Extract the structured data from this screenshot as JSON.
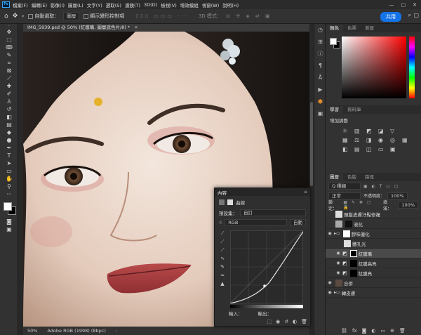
{
  "menubar": {
    "app_icon": "Ps",
    "items": [
      "檔案(F)",
      "編輯(E)",
      "影像(I)",
      "圖層(L)",
      "文字(Y)",
      "選取(S)",
      "濾鏡(T)",
      "3D(D)",
      "檢視(V)",
      "增效模組",
      "視窗(W)",
      "說明(H)"
    ],
    "window_controls": [
      "—",
      "▢",
      "✕"
    ]
  },
  "options": {
    "auto_select_label": "自動選取：",
    "auto_select_value": "圖層",
    "transform_label": "顯示變形控制項",
    "mode_3d": "3D 模式：",
    "share_label": "共用"
  },
  "document": {
    "tab_title": "IMG_5939.psd @ 50% (紅膜嘴, 圖層遮色片/8) *",
    "zoom": "50%",
    "color_profile": "Adobe RGB (1998) (8bpc)"
  },
  "color_panel": {
    "tabs": [
      "顏色",
      "色票",
      "漸層"
    ],
    "hue_color": "#ff0000"
  },
  "adjust_panel": {
    "tabs": [
      "學習",
      "資料庫"
    ],
    "title": "增加調整"
  },
  "layers_panel": {
    "tabs": [
      "圖層",
      "色版",
      "路徑"
    ],
    "filter": "Q 種類",
    "blend_mode": "正常",
    "opacity_label": "不透明度：",
    "opacity": "100%",
    "lock_label": "鎖定：",
    "fill_label": "填滿：",
    "fill": "100%",
    "layers": [
      {
        "name": "頭髮皮膚汙點修複",
        "selected": false
      },
      {
        "name": "液化",
        "selected": false
      },
      {
        "name": "膠味優化",
        "selected": false
      },
      {
        "name": "體孔光",
        "selected": false
      },
      {
        "name": "紅膜嘴",
        "selected": true
      },
      {
        "name": "紅膜高亮",
        "selected": false
      },
      {
        "name": "紅膜亮",
        "selected": false
      },
      {
        "name": "合併",
        "selected": false
      },
      {
        "name": "轉皮膚",
        "selected": false
      }
    ]
  },
  "properties": {
    "tab": "內容",
    "type_label": "曲線",
    "preset_label": "預設集：",
    "preset_value": "自訂",
    "channel_value": "RGB",
    "auto_button": "自動",
    "input_label": "輸入：",
    "output_label": "輸出："
  },
  "colors": {
    "accent": "#1473e6",
    "panel_bg": "#323232"
  }
}
